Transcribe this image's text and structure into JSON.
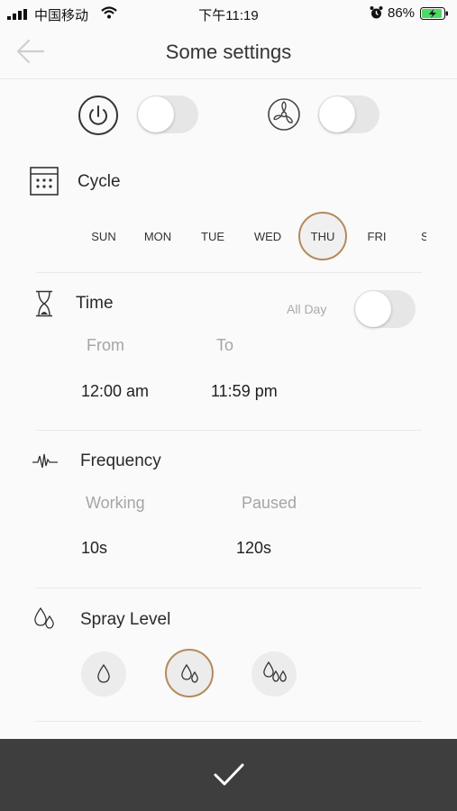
{
  "status_bar": {
    "carrier": "中国移动",
    "time": "下午11:19",
    "battery": "86%"
  },
  "header": {
    "title": "Some settings"
  },
  "toggles": {
    "power": {
      "icon": "power-icon",
      "on": false
    },
    "fan": {
      "icon": "fan-icon",
      "on": false
    }
  },
  "cycle": {
    "title": "Cycle",
    "days": [
      "SUN",
      "MON",
      "TUE",
      "WED",
      "THU",
      "FRI",
      "S"
    ],
    "selected": "THU"
  },
  "time": {
    "title": "Time",
    "all_day_label": "All Day",
    "all_day_on": false,
    "from_label": "From",
    "to_label": "To",
    "from_value": "12:00 am",
    "to_value": "11:59 pm"
  },
  "frequency": {
    "title": "Frequency",
    "working_label": "Working",
    "paused_label": "Paused",
    "working_value": "10s",
    "paused_value": "120s"
  },
  "spray_level": {
    "title": "Spray Level",
    "levels": [
      "low",
      "medium",
      "high"
    ],
    "selected": "medium"
  },
  "colors": {
    "accent": "#b48a5c",
    "bottom_bar": "#3e3e3e",
    "battery_green": "#4cd964"
  }
}
